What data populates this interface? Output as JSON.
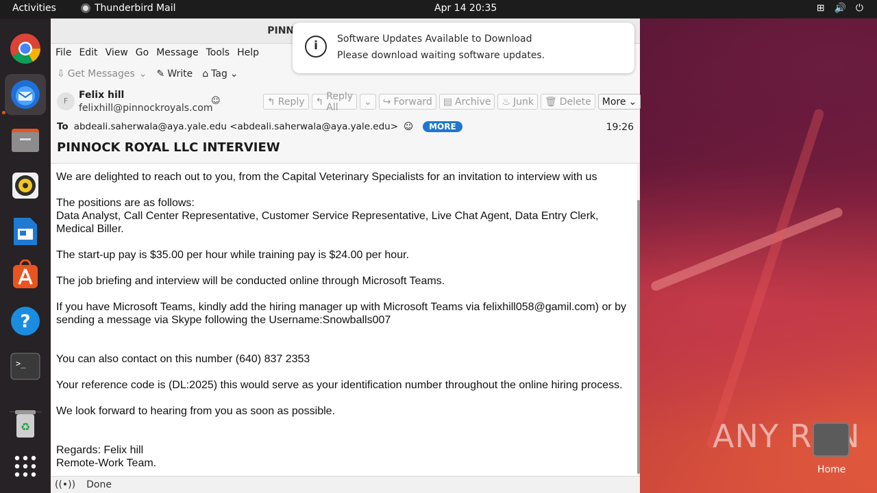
{
  "topbar": {
    "activities": "Activities",
    "app_name": "Thunderbird Mail",
    "clock": "Apr 14  20:35",
    "tray_icons": [
      "network-icon",
      "volume-icon",
      "power-icon"
    ]
  },
  "dock": {
    "items": [
      "chrome-icon",
      "thunderbird-icon",
      "files-icon",
      "rhythmbox-icon",
      "writer-icon",
      "app-center-icon",
      "help-icon",
      "terminal-icon",
      "trash-icon",
      "apps-grid-icon"
    ]
  },
  "window": {
    "title": "PINNOCK ROYAL",
    "menu": [
      "File",
      "Edit",
      "View",
      "Go",
      "Message",
      "Tools",
      "Help"
    ],
    "toolbar": {
      "get_messages": "Get Messages",
      "write": "Write",
      "tag": "Tag"
    }
  },
  "header": {
    "avatar_letter": "F",
    "from_name": "Felix hill",
    "from_email": "felixhill@pinnockroyals.com",
    "buttons": {
      "reply": "Reply",
      "reply_all": "Reply All",
      "forward": "Forward",
      "archive": "Archive",
      "junk": "Junk",
      "delete": "Delete",
      "more": "More"
    },
    "to_label": "To",
    "to_value": "abdeali.saherwala@aya.yale.edu <abdeali.saherwala@aya.yale.edu>",
    "more_badge": "MORE",
    "time": "19:26",
    "subject": "PINNOCK ROYAL LLC INTERVIEW"
  },
  "body": {
    "lines": [
      "We are delighted to reach out to you, from the Capital Veterinary Specialists for an invitation to interview with us",
      "",
      "The positions are as follows:",
      "Data Analyst, Call Center Representative, Customer Service Representative, Live Chat Agent, Data Entry Clerk,",
      "Medical Biller.",
      "",
      "The start-up pay is $35.00 per hour while training pay is $24.00 per hour.",
      "",
      "The job briefing and interview will be conducted online through Microsoft Teams.",
      "",
      "If you have Microsoft Teams, kindly add the hiring manager up with Microsoft Teams via felixhill058@gamil.com) or by",
      "sending a message via Skype following the Username:Snowballs007",
      "",
      "",
      "You can also contact on this number (640) 837 2353",
      "",
      "Your reference code is (DL:2025) this would serve as your identification number throughout the online hiring process.",
      "",
      "We look forward to hearing from you as soon as possible.",
      "",
      "",
      "Regards: Felix hill",
      "Remote-Work Team."
    ]
  },
  "status": {
    "text": "Done"
  },
  "notification": {
    "title": "Software Updates Available to Download",
    "body": "Please download waiting software updates."
  },
  "desktop": {
    "watermark": "ANY RUN",
    "home_label": "Home"
  }
}
